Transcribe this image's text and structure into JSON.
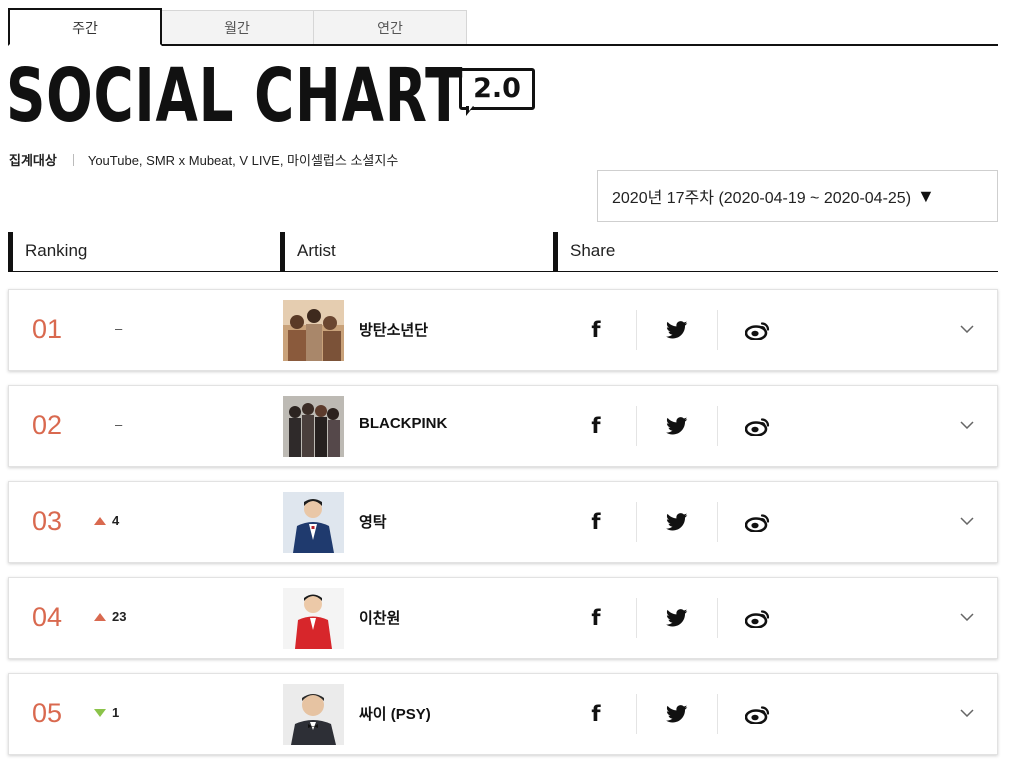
{
  "tabs": [
    {
      "label": "주간",
      "active": true
    },
    {
      "label": "월간",
      "active": false
    },
    {
      "label": "연간",
      "active": false
    }
  ],
  "title": {
    "main": "SOCIAL CHART",
    "badge": "2.0"
  },
  "source": {
    "label": "집계대상",
    "value": "YouTube, SMR x Mubeat, V LIVE, 마이셀럽스 소셜지수"
  },
  "week_select": {
    "value": "2020년 17주차 (2020-04-19 ~ 2020-04-25)",
    "icon": "caret-down-icon"
  },
  "table_header": {
    "ranking": "Ranking",
    "artist": "Artist",
    "share": "Share"
  },
  "rows": [
    {
      "rank": "01",
      "change_dir": "none",
      "change": "–",
      "artist": "방탄소년단"
    },
    {
      "rank": "02",
      "change_dir": "none",
      "change": "–",
      "artist": "BLACKPINK"
    },
    {
      "rank": "03",
      "change_dir": "up",
      "change": "4",
      "artist": "영탁"
    },
    {
      "rank": "04",
      "change_dir": "up",
      "change": "23",
      "artist": "이찬원"
    },
    {
      "rank": "05",
      "change_dir": "down",
      "change": "1",
      "artist": "싸이 (PSY)"
    }
  ],
  "colors": {
    "rank": "#d9694f",
    "up": "#d9694f",
    "down": "#8bc34a"
  }
}
